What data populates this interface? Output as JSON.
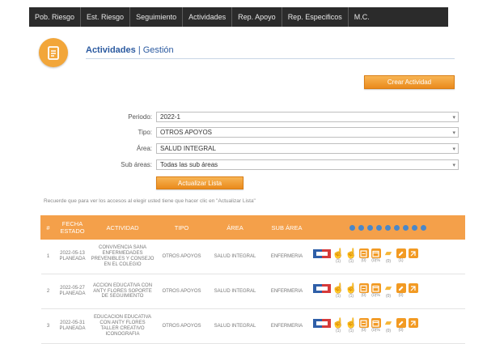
{
  "nav": {
    "tabs": [
      "Pob. Riesgo",
      "Est. Riesgo",
      "Seguimiento",
      "Actividades",
      "Rep. Apoyo",
      "Rep. Especificos",
      "M.C."
    ]
  },
  "header": {
    "title": "Actividades",
    "separator": "|",
    "subtitle": "Gestión",
    "create_button": "Crear Actividad"
  },
  "filters": {
    "periodo": {
      "label": "Periodo:",
      "value": "2022-1"
    },
    "tipo": {
      "label": "Tipo:",
      "value": "OTROS APOYOS"
    },
    "area": {
      "label": "Área:",
      "value": "SALUD INTEGRAL"
    },
    "subarea": {
      "label": "Sub áreas:",
      "value": "Todas las sub áreas"
    },
    "update_button": "Actualizar Lista"
  },
  "note": "Recuerde que para ver los accesos al elegir usted tiene que hacer clic en \"Actualizar Lista\"",
  "table": {
    "headers": [
      "#",
      "FECHA ESTADO",
      "ACTIVIDAD",
      "TIPO",
      "ÁREA",
      "SUB ÁREA"
    ],
    "rows": [
      {
        "num": "1",
        "fecha": "2022-05-13 PLANEADA",
        "actividad": "CONVIVENCIA SANA ENFERMEDADES PREVENIBLES Y CONSEJO EN EL COLEGIO",
        "tipo": "OTROS APOYOS",
        "area": "SALUD INTEGRAL",
        "subarea": "ENFERMERIA",
        "counts": [
          "(1)",
          "(1)",
          "(0)",
          "(0)%",
          "(0)",
          "(1)"
        ]
      },
      {
        "num": "2",
        "fecha": "2022-05-27 PLANEADA",
        "actividad": "ACCION EDUCATIVA CON ANTY FLORES SOPORTE DE SEGUIMIENTO",
        "tipo": "OTROS APOYOS",
        "area": "SALUD INTEGRAL",
        "subarea": "ENFERMERIA",
        "counts": [
          "(1)",
          "(1)",
          "(0)",
          "(0)%",
          "(0)",
          "(0)"
        ]
      },
      {
        "num": "3",
        "fecha": "2022-05-31 PLANEADA",
        "actividad": "EDUCACION EDUCATIVA CON ANTY FLORES TALLER CREATIVO ICONOGRAFIA",
        "tipo": "OTROS APOYOS",
        "area": "SALUD INTEGRAL",
        "subarea": "ENFERMERIA",
        "counts": [
          "(1)",
          "(1)",
          "(0)",
          "(0)%",
          "(0)",
          "(0)"
        ]
      }
    ]
  }
}
